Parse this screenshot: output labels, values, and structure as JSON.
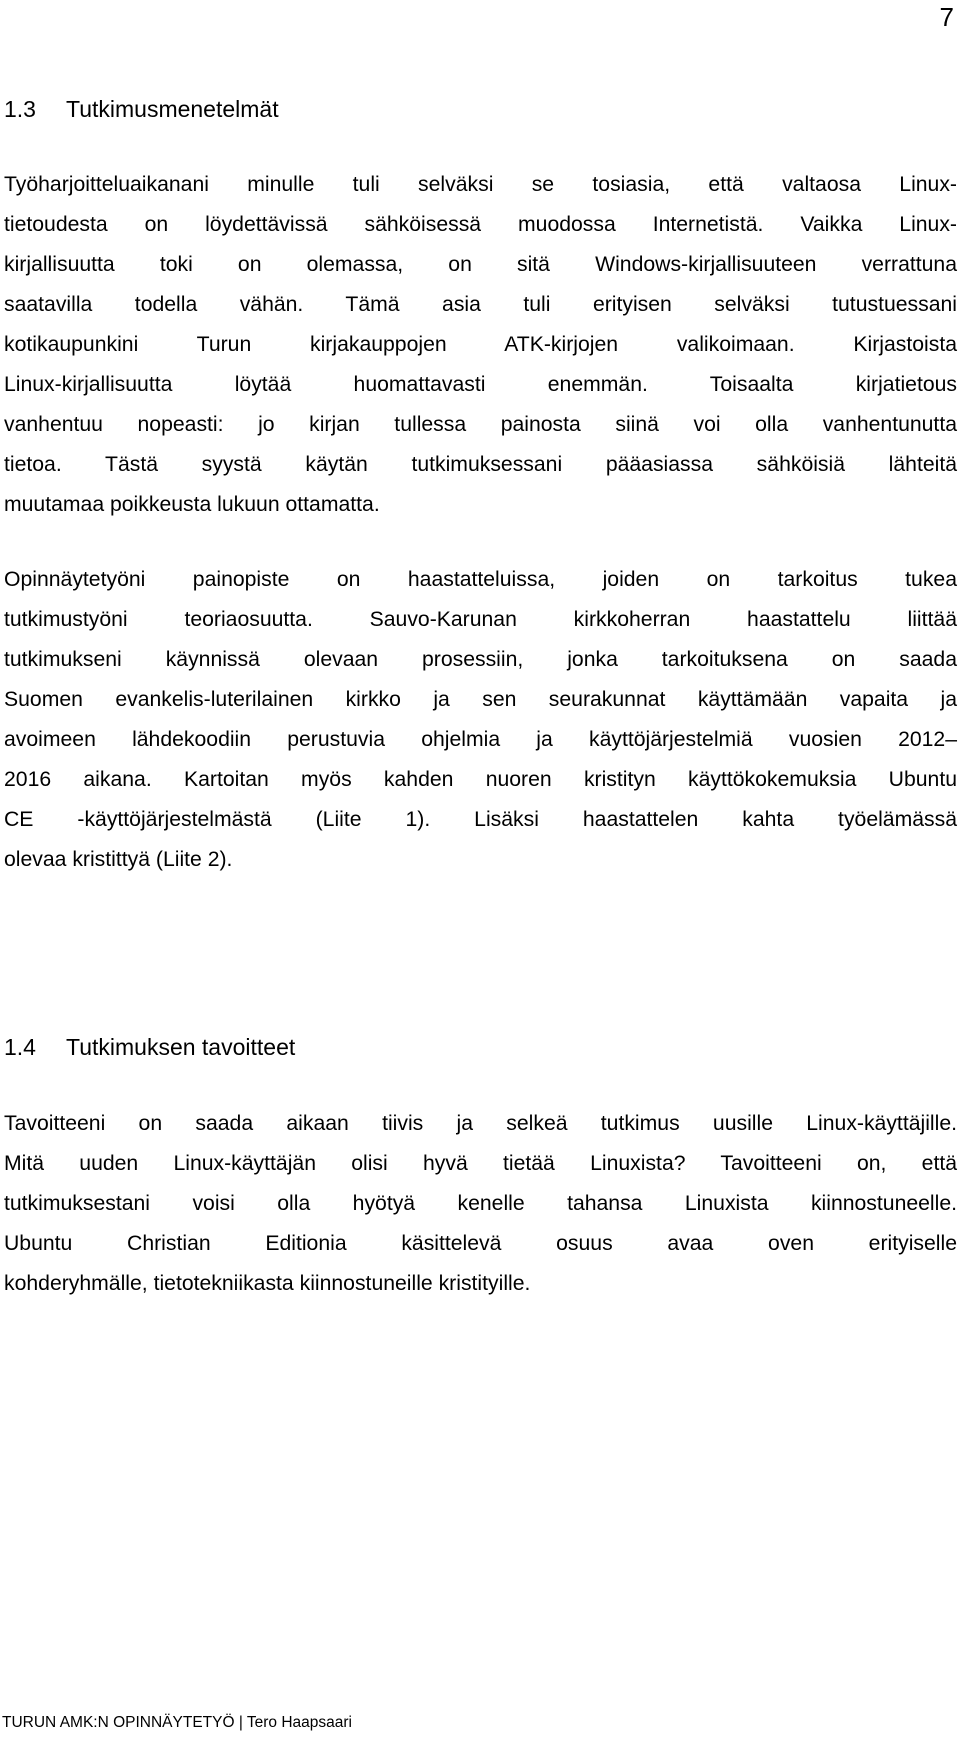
{
  "page_number": "7",
  "sections": [
    {
      "number": "1.3",
      "title": "Tutkimusmenetelmät",
      "paragraphs": [
        {
          "lines": [
            "Työharjoitteluaikanani minulle tuli selväksi se tosiasia, että valtaosa Linux-",
            "tietoudesta on löydettävissä sähköisessä muodossa Internetistä. Vaikka Linux-",
            "kirjallisuutta toki on olemassa, on sitä Windows-kirjallisuuteen verrattuna",
            "saatavilla todella vähän. Tämä asia tuli erityisen selväksi tutustuessani",
            "kotikaupunkini Turun kirjakauppojen ATK-kirjojen valikoimaan. Kirjastoista",
            "Linux-kirjallisuutta löytää huomattavasti enemmän. Toisaalta kirjatietous",
            "vanhentuu nopeasti: jo kirjan tullessa painosta siinä voi olla vanhentunutta",
            "tietoa. Tästä syystä käytän tutkimuksessani pääasiassa sähköisiä lähteitä",
            "muutamaa poikkeusta lukuun ottamatta."
          ]
        },
        {
          "lines": [
            "Opinnäytetyöni painopiste on haastatteluissa, joiden on tarkoitus tukea",
            "tutkimustyöni teoriaosuutta. Sauvo-Karunan kirkkoherran haastattelu liittää",
            "tutkimukseni käynnissä olevaan prosessiin, jonka tarkoituksena on saada",
            "Suomen evankelis-luterilainen kirkko ja sen seurakunnat käyttämään vapaita ja",
            "avoimeen lähdekoodiin perustuvia ohjelmia ja käyttöjärjestelmiä vuosien 2012–",
            "2016 aikana. Kartoitan myös kahden nuoren kristityn käyttökokemuksia Ubuntu",
            "CE -käyttöjärjestelmästä (Liite 1). Lisäksi haastattelen kahta työelämässä",
            "olevaa kristittyä (Liite 2)."
          ]
        }
      ]
    },
    {
      "number": "1.4",
      "title": "Tutkimuksen tavoitteet",
      "paragraphs": [
        {
          "lines": [
            "Tavoitteeni on saada aikaan tiivis ja selkeä tutkimus uusille Linux-käyttäjille.",
            "Mitä uuden Linux-käyttäjän olisi hyvä tietää Linuxista? Tavoitteeni on, että",
            "tutkimuksestani voisi olla hyötyä kenelle tahansa Linuxista kiinnostuneelle.",
            "Ubuntu Christian Editionia käsittelevä osuus avaa oven erityiselle",
            "kohderyhmälle, tietotekniikasta kiinnostuneille kristityille."
          ]
        }
      ]
    }
  ],
  "footer": "TURUN AMK:N OPINNÄYTETYÖ | Tero Haapsaari"
}
